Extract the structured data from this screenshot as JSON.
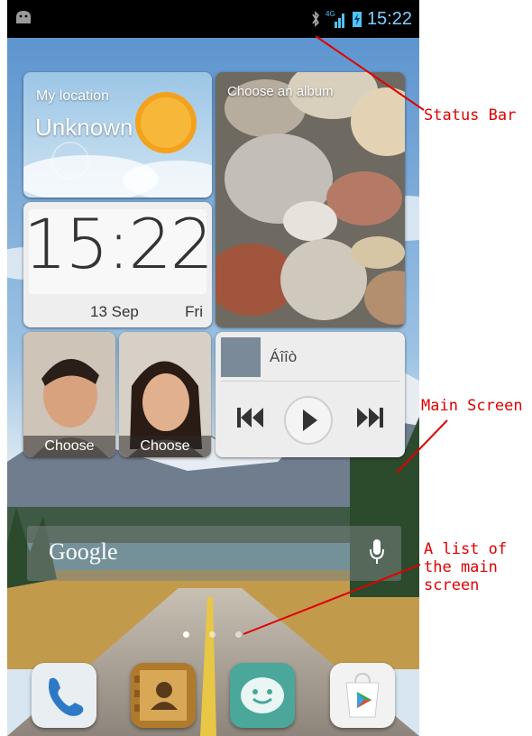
{
  "status_bar": {
    "bluetooth_icon": "bluetooth-icon",
    "network": "4G",
    "battery_icon": "battery-charging-icon",
    "time": "15:22"
  },
  "widgets": {
    "location": {
      "title": "My location",
      "value": "Unknown"
    },
    "album": {
      "title": "Choose an album"
    },
    "clock": {
      "time": "15:22",
      "date": "13 Sep",
      "day": "Fri"
    },
    "contacts": [
      {
        "label": "Choose"
      },
      {
        "label": "Choose"
      }
    ],
    "music": {
      "title": "Áîîò"
    }
  },
  "search": {
    "logo": "Google"
  },
  "pages": {
    "count": 3,
    "active": 0
  },
  "dock": [
    "phone-icon",
    "contacts-icon",
    "messaging-icon",
    "play-store-icon"
  ],
  "annotations": {
    "status_bar": "Status Bar",
    "main_screen": "Main Screen",
    "list_line1": "A list of",
    "list_line2": "the main",
    "list_line3": "screen"
  },
  "colors": {
    "annotation": "#e00000",
    "clock_accent": "#7fd0ff"
  }
}
